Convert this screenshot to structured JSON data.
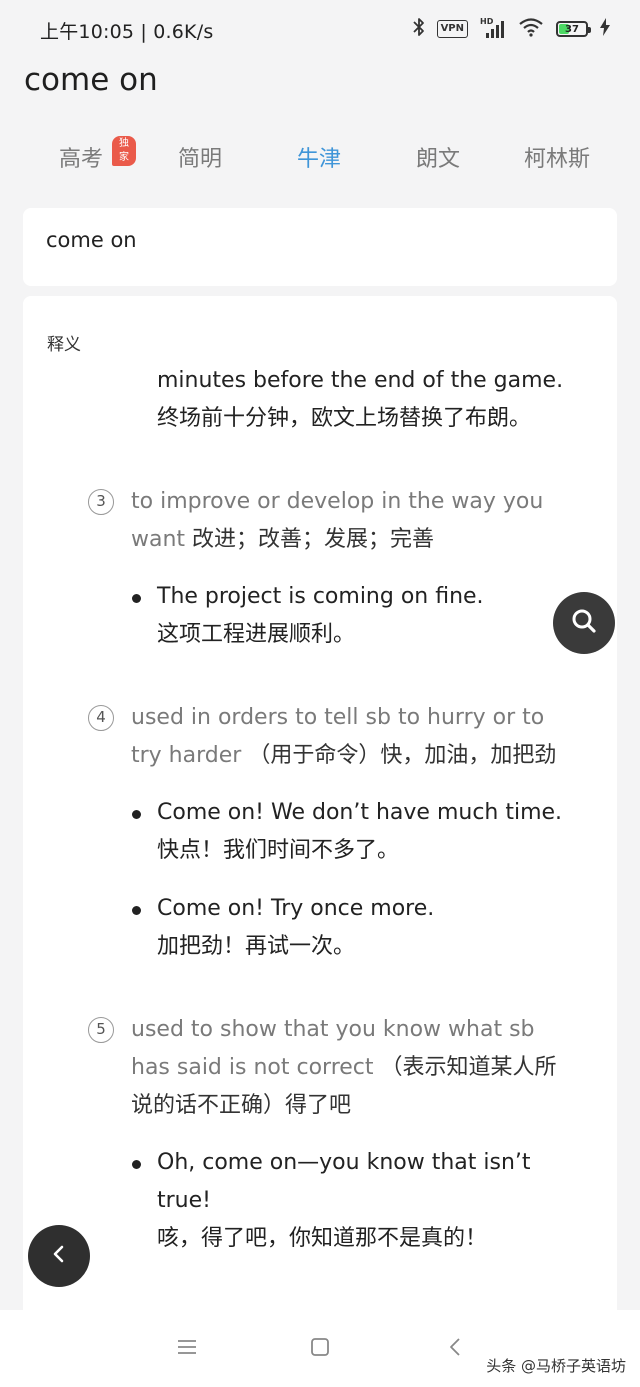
{
  "status_bar": {
    "time_speed": "上午10:05 | 0.6K/s",
    "vpn_label": "VPN",
    "hd_label": "HD",
    "battery_level": "37",
    "battery_fraction": 0.37
  },
  "header": {
    "title": "come on"
  },
  "tabs": [
    {
      "label": "高考",
      "badge": "独家",
      "active": false
    },
    {
      "label": "简明",
      "active": false
    },
    {
      "label": "牛津",
      "active": true
    },
    {
      "label": "朗文",
      "active": false
    },
    {
      "label": "柯林斯",
      "active": false
    }
  ],
  "search": {
    "value": "come on"
  },
  "definitions": {
    "section_label": "释义",
    "partial_example": {
      "en": "minutes before the end of the game.",
      "zh": "终场前十分钟，欧文上场替换了布朗。"
    },
    "senses": [
      {
        "number": "3",
        "en_line1": "to improve or develop in the way you",
        "en_line2": "want",
        "zh_inline": "改进；改善；发展；完善",
        "examples": [
          {
            "en": "The project is coming on fine.",
            "zh": "这项工程进展顺利。"
          }
        ]
      },
      {
        "number": "4",
        "en_line1": "used in orders to tell sb to hurry or to",
        "en_line2": "try harder",
        "zh_inline": "（用于命令）快，加油，加把劲",
        "examples": [
          {
            "en": "Come on! We don’t have much time.",
            "zh": "快点！我们时间不多了。"
          },
          {
            "en": "Come on! Try once more.",
            "zh": "加把劲！再试一次。"
          }
        ]
      },
      {
        "number": "5",
        "en_line1": "used to show that you know what sb",
        "en_line2": "has said is not correct",
        "zh_inline": "（表示知道某人所",
        "zh_line3": "说的话不正确）得了吧",
        "examples": [
          {
            "en_line1": "Oh, come on—you know that isn’t",
            "en_line2": "true!",
            "zh": "咳，得了吧，你知道那不是真的！"
          }
        ]
      }
    ]
  },
  "watermark": "头条 @马桥子英语坊",
  "colors": {
    "accent": "#3f95d8",
    "badge": "#ea5a4a",
    "background": "#f4f4f5",
    "fab": "#3a3a3a"
  },
  "icons": {
    "bluetooth": "bluetooth-icon",
    "signal": "signal-icon",
    "wifi": "wifi-icon",
    "charging": "charging-icon",
    "search_fab": "search-icon",
    "back_fab": "chevron-left-icon",
    "nav_menu": "menu-icon",
    "nav_home": "home-icon",
    "nav_back": "back-icon"
  }
}
